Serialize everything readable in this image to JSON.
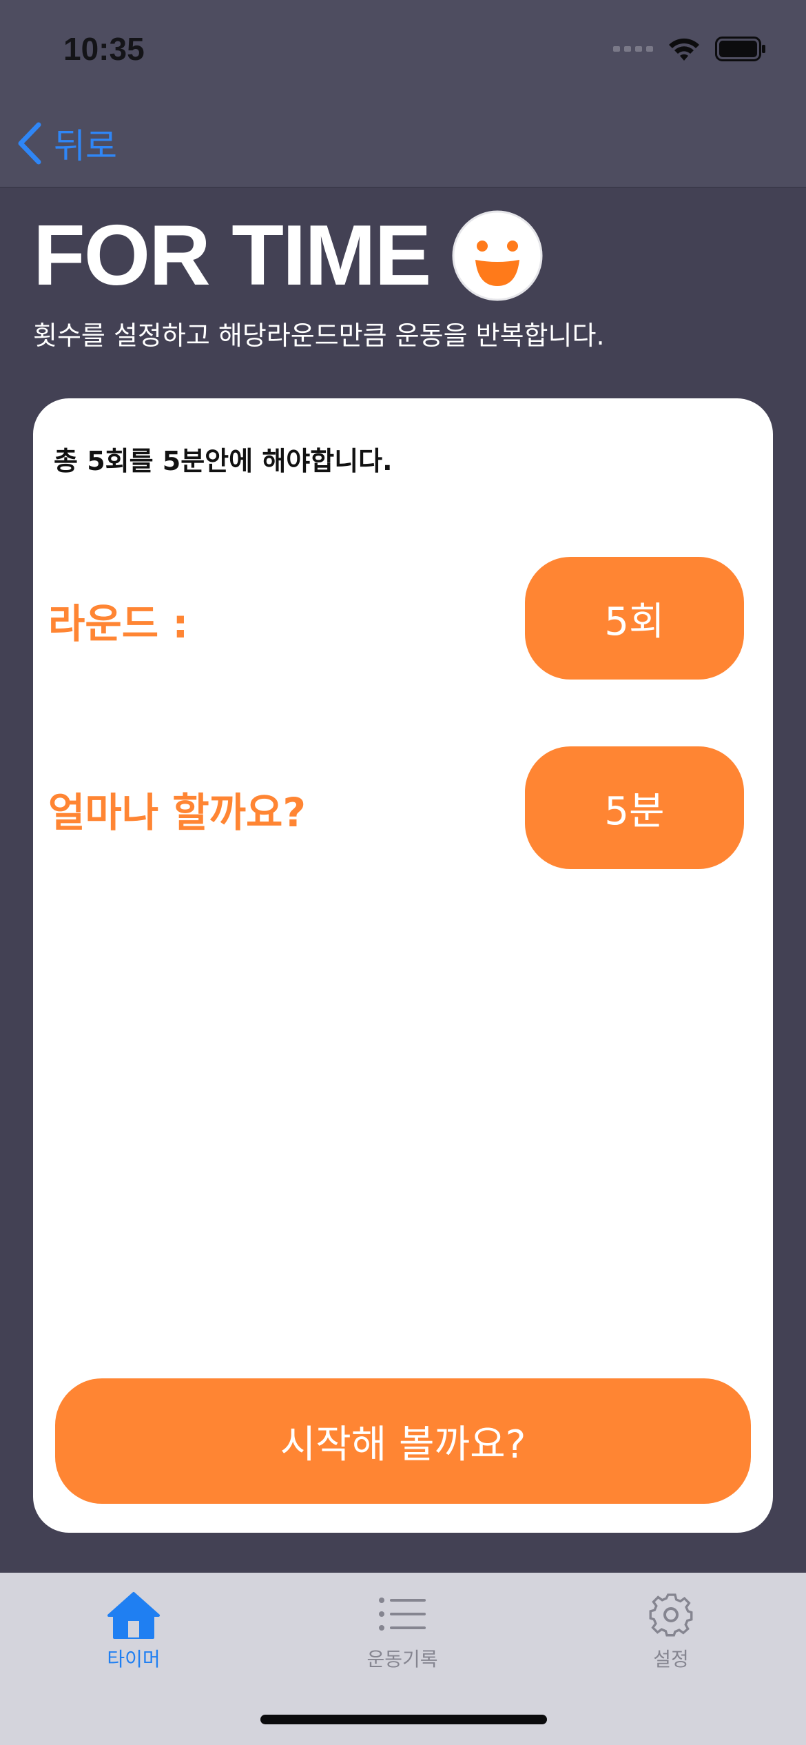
{
  "status_bar": {
    "time": "10:35"
  },
  "nav": {
    "back_label": "뒤로"
  },
  "header": {
    "title": "FOR TIME",
    "subtitle": "횟수를 설정하고 해당라운드만큼 운동을 반복합니다."
  },
  "card": {
    "summary": "총 5회를 5분안에 해야합니다.",
    "rounds_label": "라운드 :",
    "rounds_value": "5회",
    "duration_label": "얼마나 할까요?",
    "duration_value": "5분",
    "start_label": "시작해 볼까요?"
  },
  "tabbar": {
    "items": [
      {
        "label": "타이머",
        "icon": "home-icon",
        "active": true
      },
      {
        "label": "운동기록",
        "icon": "list-icon",
        "active": false
      },
      {
        "label": "설정",
        "icon": "gear-icon",
        "active": false
      }
    ]
  },
  "colors": {
    "accent": "#ff8533",
    "background": "#434154",
    "link": "#2f86f6"
  }
}
